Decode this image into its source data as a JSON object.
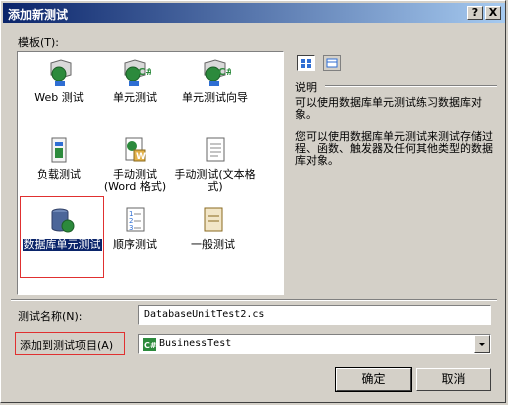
{
  "window": {
    "title": "添加新测试",
    "help_label": "?",
    "close_label": "X"
  },
  "templates_label": "模板(T):",
  "templates": [
    {
      "id": "web",
      "label": "Web 测试",
      "icon": "web-test-icon"
    },
    {
      "id": "unit",
      "label": "单元测试",
      "icon": "unit-test-icon"
    },
    {
      "id": "unit-wizard",
      "label": "单元测试向导",
      "icon": "unit-test-wizard-icon"
    },
    {
      "id": "load",
      "label": "负载测试",
      "icon": "load-test-icon"
    },
    {
      "id": "manual-word",
      "label": "手动测试(Word 格式)",
      "icon": "manual-word-test-icon"
    },
    {
      "id": "manual-text",
      "label": "手动测试(文本格式)",
      "icon": "manual-text-test-icon"
    },
    {
      "id": "db-unit",
      "label": "数据库单元测试",
      "icon": "database-unit-test-icon",
      "selected": true
    },
    {
      "id": "ordered",
      "label": "顺序测试",
      "icon": "ordered-test-icon"
    },
    {
      "id": "generic",
      "label": "一般测试",
      "icon": "generic-test-icon"
    }
  ],
  "view_buttons": {
    "large_icons": "large-icons-view-icon",
    "small_icons": "small-icons-view-icon"
  },
  "description": {
    "heading": "说明",
    "text1": "可以使用数据库单元测试练习数据库对象。",
    "text2": "您可以使用数据库单元测试来测试存储过程、函数、触发器及任何其他类型的数据库对象。"
  },
  "test_name": {
    "label": "测试名称(N):",
    "value": "DatabaseUnitTest2.cs"
  },
  "add_to_project": {
    "label": "添加到测试项目(A)",
    "value": "BusinessTest",
    "icon": "csharp-project-icon"
  },
  "buttons": {
    "ok": "确定",
    "cancel": "取消"
  },
  "colors": {
    "title_bar": "#0a246a",
    "selection": "#0a246a",
    "highlight_box": "#e03030",
    "dialog": "#d4d0c8"
  }
}
